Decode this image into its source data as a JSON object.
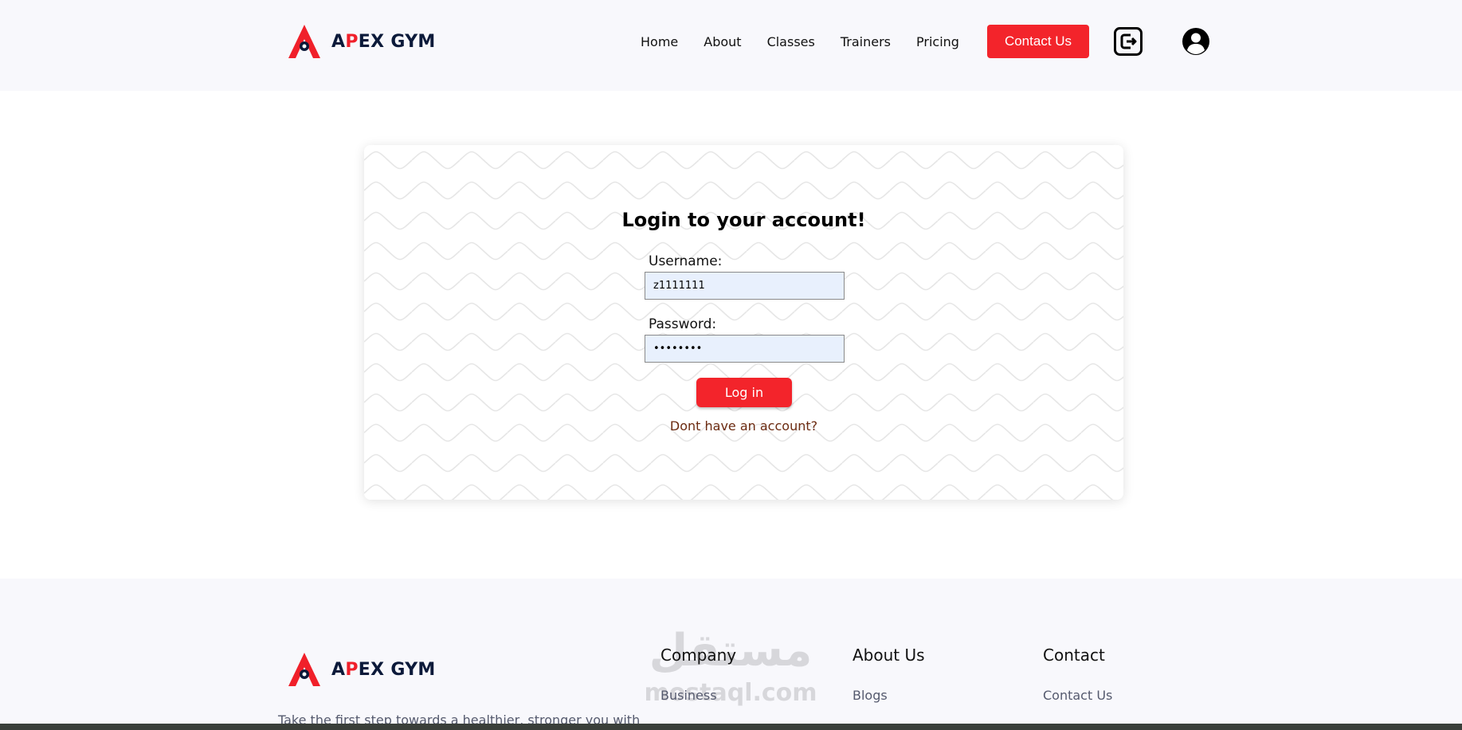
{
  "brand": {
    "name_prefix": "A",
    "name_accent": "P",
    "name_rest": "EX GYM",
    "accent_color": "#f3242b",
    "dark_color": "#0c1a3a"
  },
  "nav": {
    "items": [
      {
        "label": "Home"
      },
      {
        "label": "About"
      },
      {
        "label": "Classes"
      },
      {
        "label": "Trainers"
      },
      {
        "label": "Pricing"
      }
    ],
    "contact_label": "Contact Us",
    "logout_icon": "logout-icon",
    "user_icon": "user-icon"
  },
  "login": {
    "title": "Login to your account!",
    "username_label": "Username:",
    "username_value": "z1111111",
    "password_label": "Password:",
    "password_value": "password",
    "submit_label": "Log in",
    "signup_link": "Dont have an account?"
  },
  "footer": {
    "description": "Take the first step towards a healthier, stronger you with",
    "columns": [
      {
        "title": "Company",
        "links": [
          "Business"
        ]
      },
      {
        "title": "About Us",
        "links": [
          "Blogs"
        ]
      },
      {
        "title": "Contact",
        "links": [
          "Contact Us"
        ]
      }
    ],
    "watermark_ar": "مستقل",
    "watermark_lat": "mostaql.com"
  }
}
